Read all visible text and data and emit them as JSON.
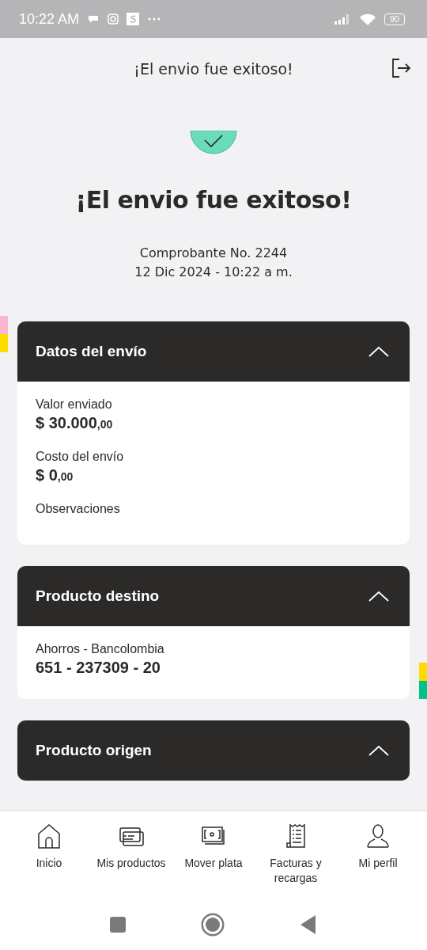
{
  "status_bar": {
    "time": "10:22 AM",
    "battery": "90"
  },
  "header": {
    "title": "¡El envio fue exitoso!"
  },
  "hero": {
    "title": "¡El envio fue exitoso!",
    "receipt": "Comprobante No. 2244",
    "date": "12 Dic 2024 - 10:22 a m."
  },
  "sections": [
    {
      "title": "Datos del envío",
      "expanded": true,
      "fields": [
        {
          "label": "Valor enviado",
          "amount": "$ 30.000",
          "cents": ",00"
        },
        {
          "label": "Costo del envío",
          "amount": "$ 0",
          "cents": ",00"
        },
        {
          "label": "Observaciones"
        }
      ]
    },
    {
      "title": "Producto destino",
      "expanded": true,
      "fields": [
        {
          "label": "Ahorros - Bancolombia",
          "amount": "651 - 237309 - 20"
        }
      ]
    },
    {
      "title": "Producto origen",
      "expanded": true
    }
  ],
  "nav": [
    {
      "label": "Inicio",
      "kind": "home"
    },
    {
      "label": "Mis productos",
      "kind": "cards"
    },
    {
      "label": "Mover plata",
      "kind": "money"
    },
    {
      "label": "Facturas y recargas",
      "kind": "receipt"
    },
    {
      "label": "Mi perfil",
      "kind": "person"
    }
  ]
}
